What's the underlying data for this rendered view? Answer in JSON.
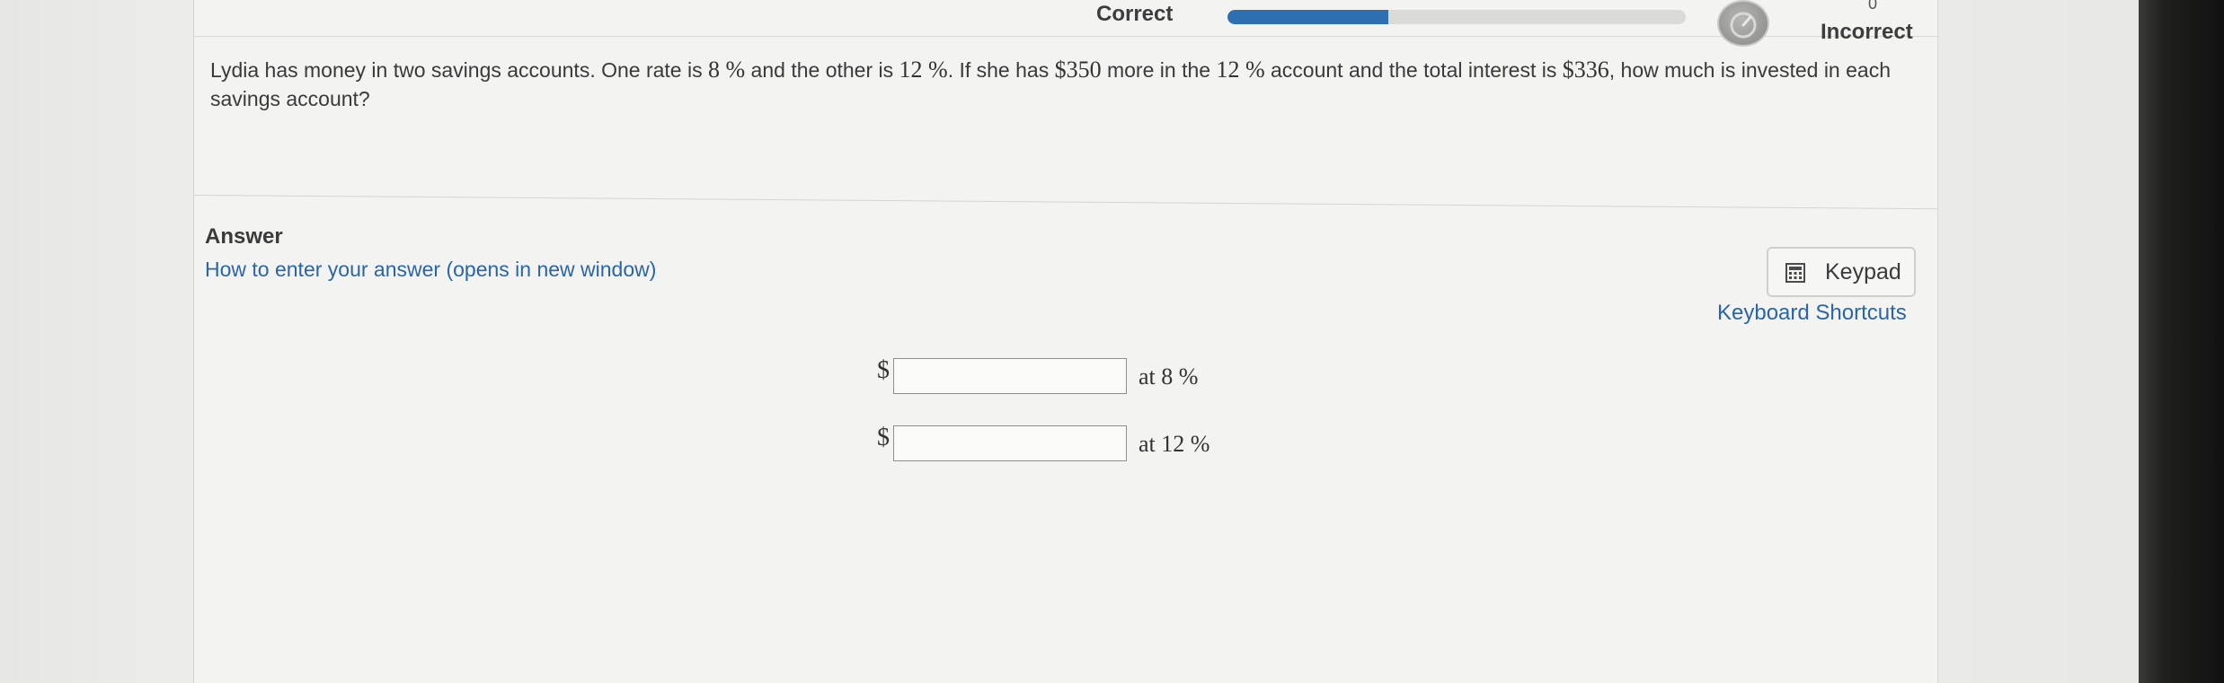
{
  "header": {
    "correct_label": "Correct",
    "incorrect_label": "Incorrect",
    "incorrect_count": "0",
    "progress_fraction": 0.35
  },
  "question": {
    "part1": "Lydia has money in two savings accounts. One rate is ",
    "rate1": "8 %",
    "part2": " and the other is ",
    "rate2": "12 %",
    "part3": ". If she has ",
    "amount_more": "$350",
    "part4": " more in the ",
    "rate3": "12 %",
    "part5": " account and the total interest is ",
    "total_interest": "$336",
    "part6": ", how much is invested in each savings account?"
  },
  "answer": {
    "heading": "Answer",
    "howto_link": "How to enter your answer (opens in new window)",
    "keypad_label": "Keypad",
    "shortcuts_link": "Keyboard Shortcuts",
    "rows": [
      {
        "currency": "$",
        "value": "",
        "rate_label": "at 8 %"
      },
      {
        "currency": "$",
        "value": "",
        "rate_label": "at 12 %"
      }
    ]
  },
  "icons": {
    "progress_gauge": "gauge-icon",
    "keypad": "keypad-icon"
  },
  "colors": {
    "link": "#2a65a8",
    "progress": "#2d6fb1"
  }
}
